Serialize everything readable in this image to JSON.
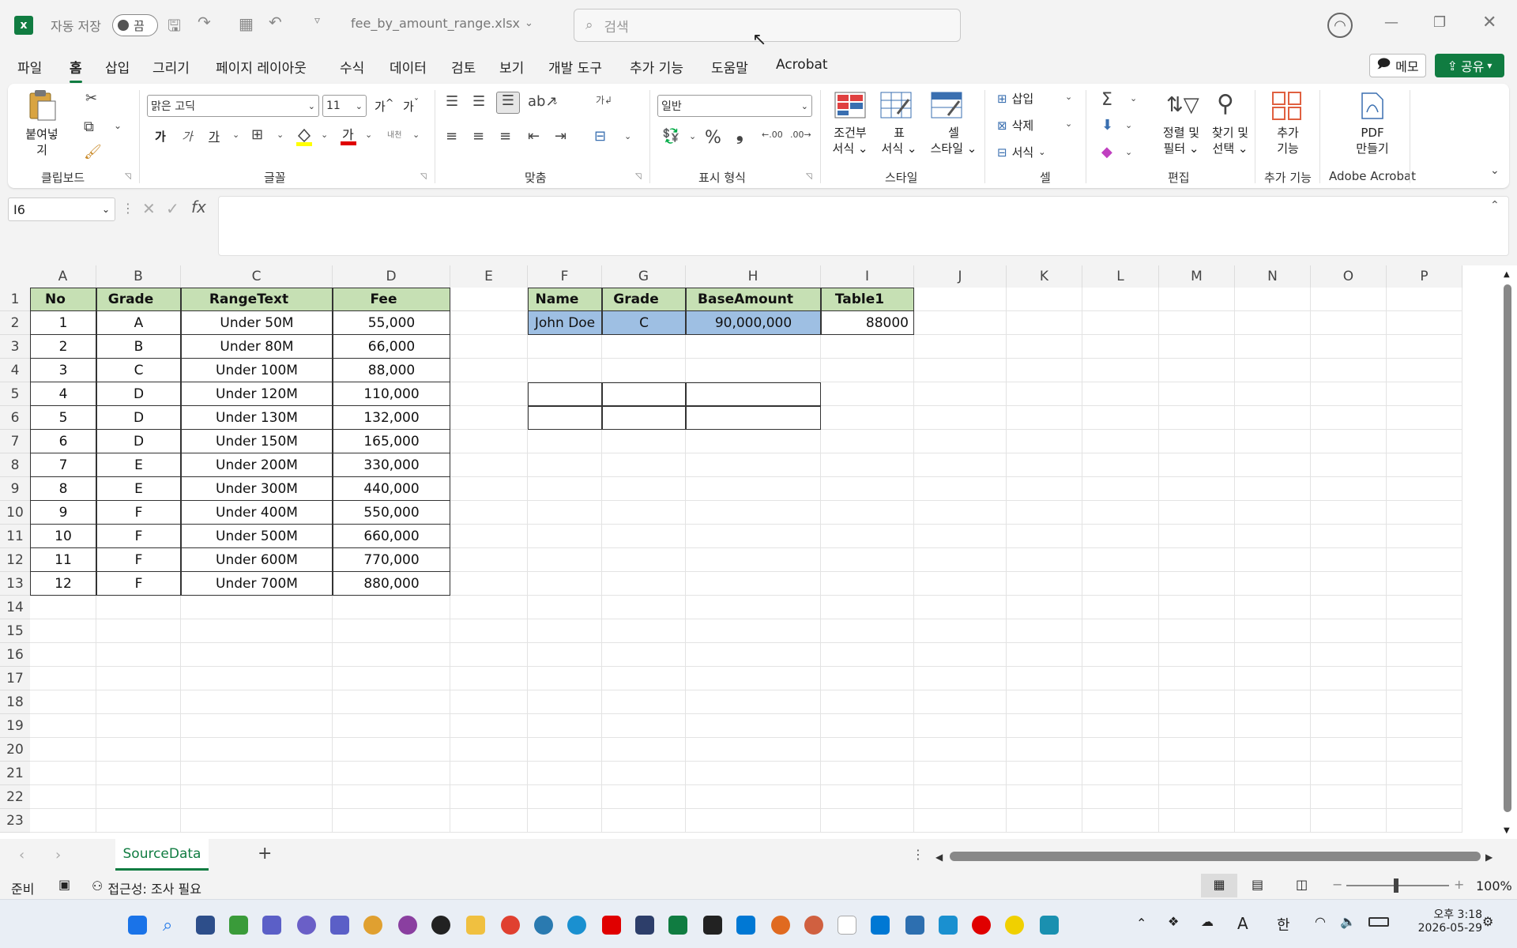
{
  "titlebar": {
    "autosave_label": "자동 저장",
    "autosave_state": "끔",
    "filename": "fee_by_amount_range.xlsx",
    "search_placeholder": "검색"
  },
  "menu": {
    "tabs": [
      "파일",
      "홈",
      "삽입",
      "그리기",
      "페이지 레이아웃",
      "수식",
      "데이터",
      "검토",
      "보기",
      "개발 도구",
      "추가 기능",
      "도움말",
      "Acrobat"
    ],
    "active": "홈",
    "memo": "메모",
    "share": "공유"
  },
  "ribbon": {
    "clipboard": {
      "paste": "붙여넣기",
      "label": "클립보드"
    },
    "font": {
      "name": "맑은 고딕",
      "size": "11",
      "label": "글꼴",
      "bold": "가",
      "italic": "가",
      "underline": "가",
      "inc": "가^",
      "dec": "가ˇ"
    },
    "align": {
      "label": "맞춤"
    },
    "number": {
      "format": "일반",
      "label": "표시 형식"
    },
    "styles": {
      "cond": "조건부\n서식",
      "cond1": "조건부",
      "cond2": "서식",
      "table1": "표",
      "table2": "서식",
      "cell1": "셀",
      "cell2": "스타일",
      "label": "스타일"
    },
    "cells": {
      "insert": "삽입",
      "delete": "삭제",
      "format": "서식",
      "label": "셀"
    },
    "editing": {
      "sort1": "정렬 및",
      "sort2": "필터",
      "find1": "찾기 및",
      "find2": "선택",
      "label": "편집"
    },
    "addins": {
      "l1": "추가",
      "l2": "기능",
      "label": "추가 기능"
    },
    "acrobat": {
      "l1": "PDF",
      "l2": "만들기",
      "label": "Adobe Acrobat"
    }
  },
  "formula_bar": {
    "name_box": "I6",
    "formula": ""
  },
  "columns": [
    "A",
    "B",
    "C",
    "D",
    "E",
    "F",
    "G",
    "H",
    "I",
    "J",
    "K",
    "L",
    "M",
    "N",
    "O",
    "P"
  ],
  "rows": [
    "1",
    "2",
    "3",
    "4",
    "5",
    "6",
    "7",
    "8",
    "9",
    "10",
    "11",
    "12",
    "13",
    "14",
    "15",
    "16",
    "17",
    "18",
    "19",
    "20",
    "21",
    "22",
    "23"
  ],
  "table_source": {
    "headers": [
      "No",
      "Grade",
      "RangeText",
      "Fee"
    ],
    "rows": [
      [
        "1",
        "A",
        "Under 50M",
        "55,000"
      ],
      [
        "2",
        "B",
        "Under 80M",
        "66,000"
      ],
      [
        "3",
        "C",
        "Under 100M",
        "88,000"
      ],
      [
        "4",
        "D",
        "Under 120M",
        "110,000"
      ],
      [
        "5",
        "D",
        "Under 130M",
        "132,000"
      ],
      [
        "6",
        "D",
        "Under 150M",
        "165,000"
      ],
      [
        "7",
        "E",
        "Under 200M",
        "330,000"
      ],
      [
        "8",
        "E",
        "Under 300M",
        "440,000"
      ],
      [
        "9",
        "F",
        "Under 400M",
        "550,000"
      ],
      [
        "10",
        "F",
        "Under 500M",
        "660,000"
      ],
      [
        "11",
        "F",
        "Under 600M",
        "770,000"
      ],
      [
        "12",
        "F",
        "Under 700M",
        "880,000"
      ]
    ]
  },
  "table_lookup": {
    "headers": [
      "Name",
      "Grade",
      "BaseAmount",
      "Table1"
    ],
    "row": [
      "John Doe",
      "C",
      "90,000,000",
      "88000"
    ]
  },
  "sheets": {
    "active": "SourceData",
    "add": "+"
  },
  "status": {
    "ready": "준비",
    "accessibility": "접근성: 조사 필요",
    "zoom": "100%"
  },
  "taskbar": {
    "time": "오후 3:18",
    "date": "2026-05-29",
    "ime": "한"
  }
}
